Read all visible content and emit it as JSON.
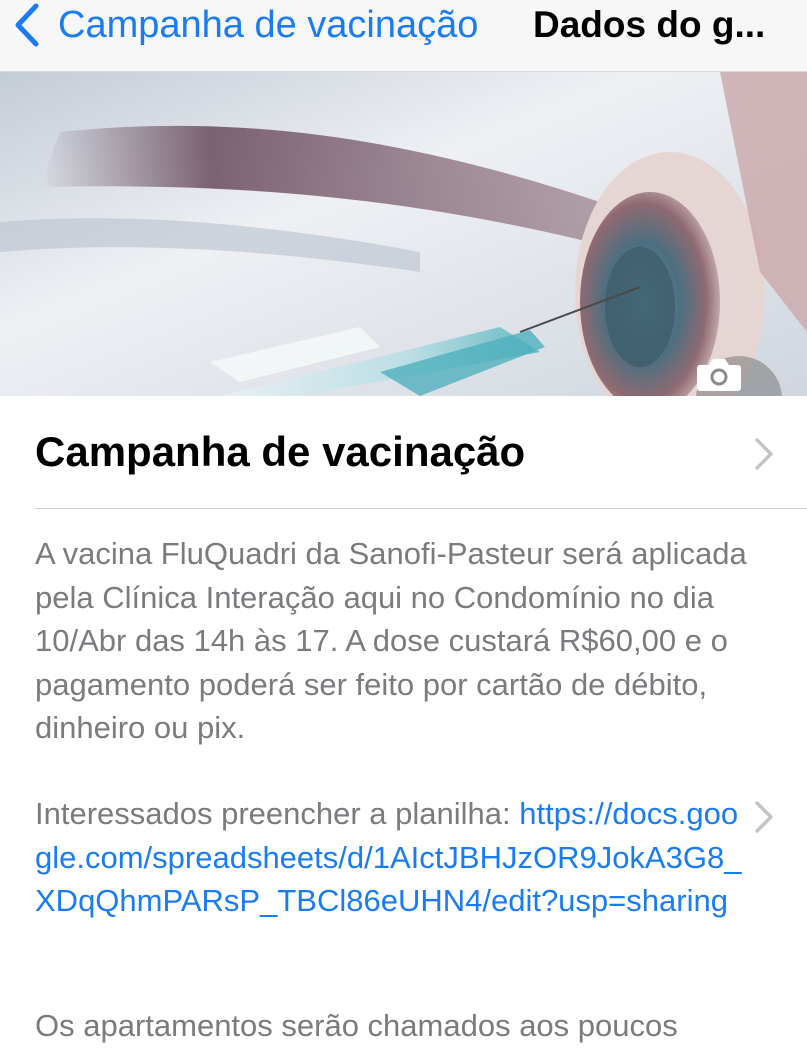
{
  "navbar": {
    "back_label": "Campanha de vacinação",
    "title": "Dados do g..."
  },
  "hero": {
    "image_icon": "vaccine-photo",
    "camera_icon": "camera-icon"
  },
  "group": {
    "name": "Campanha de vacinação"
  },
  "description": {
    "paragraph": "A vacina FluQuadri da Sanofi-Pasteur será aplicada pela Clínica Interação aqui no Condomínio no dia 10/Abr das 14h às 17. A dose custará R$60,00 e o pagamento poderá ser feito por cartão de débito, dinheiro ou pix.",
    "link_prefix": "Interessados preencher a planilha: ",
    "link_url": "https://docs.google.com/spreadsheets/d/1AIctJBHJzOR9JokA3G8_XDqQhmPARsP_TBCl86eUHN4/edit?usp=sharing",
    "cut_line": "Os apartamentos serão chamados aos poucos"
  },
  "colors": {
    "accent": "#1a7cf4",
    "secondary_text": "#7b7b7f",
    "navbar_bg": "#f7f7f7"
  }
}
